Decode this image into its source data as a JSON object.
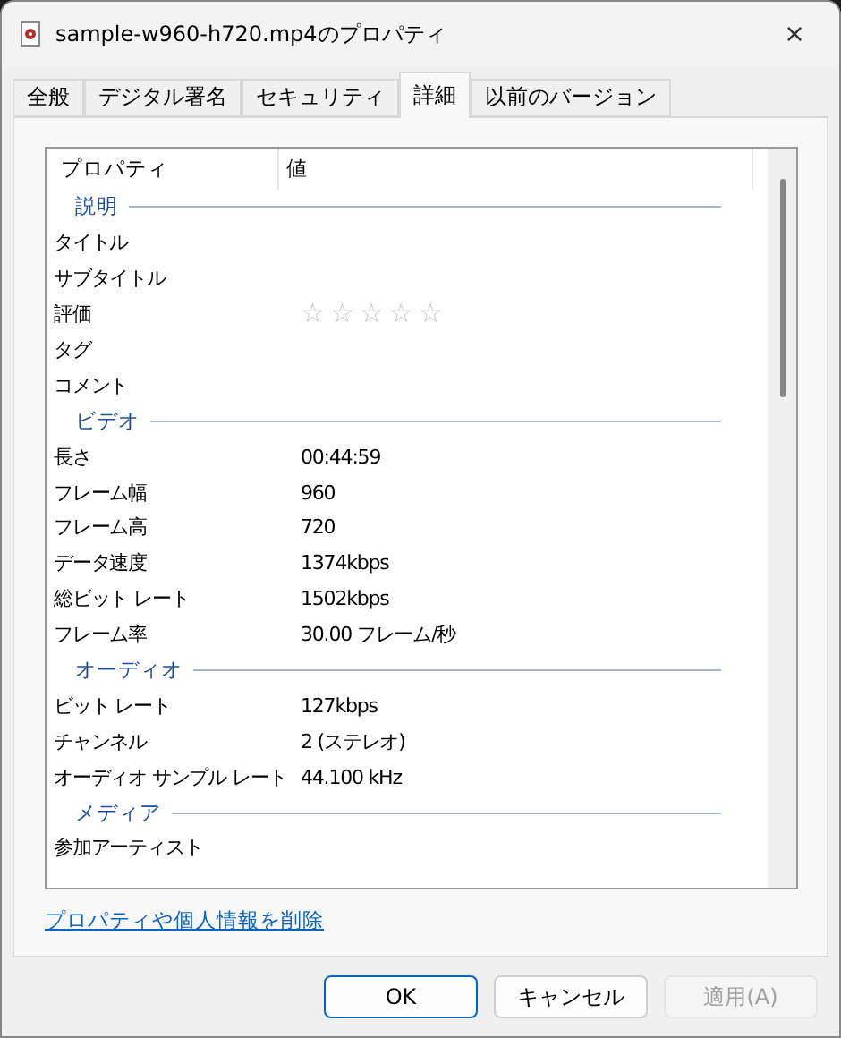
{
  "window": {
    "title": "sample-w960-h720.mp4のプロパティ",
    "close": "×"
  },
  "tabs": [
    {
      "label": "全般",
      "selected": false
    },
    {
      "label": "デジタル署名",
      "selected": false
    },
    {
      "label": "セキュリティ",
      "selected": false
    },
    {
      "label": "詳細",
      "selected": true
    },
    {
      "label": "以前のバージョン",
      "selected": false
    }
  ],
  "table": {
    "columns": [
      "プロパティ",
      "値"
    ],
    "rows": [
      {
        "kind": "group",
        "label": "説明"
      },
      {
        "kind": "prop",
        "name": "タイトル"
      },
      {
        "kind": "prop",
        "name": "サブタイトル"
      },
      {
        "kind": "rating",
        "name": "評価",
        "stars": 0
      },
      {
        "kind": "prop",
        "name": "タグ"
      },
      {
        "kind": "prop",
        "name": "コメント"
      },
      {
        "kind": "group",
        "label": "ビデオ"
      },
      {
        "kind": "prop",
        "name": "長さ",
        "value": "00:44:59"
      },
      {
        "kind": "prop",
        "name": "フレーム幅",
        "value": "960"
      },
      {
        "kind": "prop",
        "name": "フレーム高",
        "value": "720"
      },
      {
        "kind": "prop",
        "name": "データ速度",
        "value": "1374kbps"
      },
      {
        "kind": "prop",
        "name": "総ビット レート",
        "value": "1502kbps"
      },
      {
        "kind": "prop",
        "name": "フレーム率",
        "value": "30.00 フレーム/秒"
      },
      {
        "kind": "group",
        "label": "オーディオ"
      },
      {
        "kind": "prop",
        "name": "ビット レート",
        "value": "127kbps"
      },
      {
        "kind": "prop",
        "name": "チャンネル",
        "value": "2 (ステレオ)"
      },
      {
        "kind": "prop",
        "name": "オーディオ サンプル レート",
        "value": "44.100 kHz"
      },
      {
        "kind": "group",
        "label": "メディア"
      },
      {
        "kind": "prop",
        "name": "参加アーティスト"
      }
    ]
  },
  "link": "プロパティや個人情報を削除",
  "buttons": [
    {
      "label": "OK",
      "disabled": false,
      "default": true
    },
    {
      "label": "キャンセル",
      "disabled": false,
      "default": false
    },
    {
      "label": "適用(A)",
      "disabled": true,
      "default": false
    }
  ]
}
